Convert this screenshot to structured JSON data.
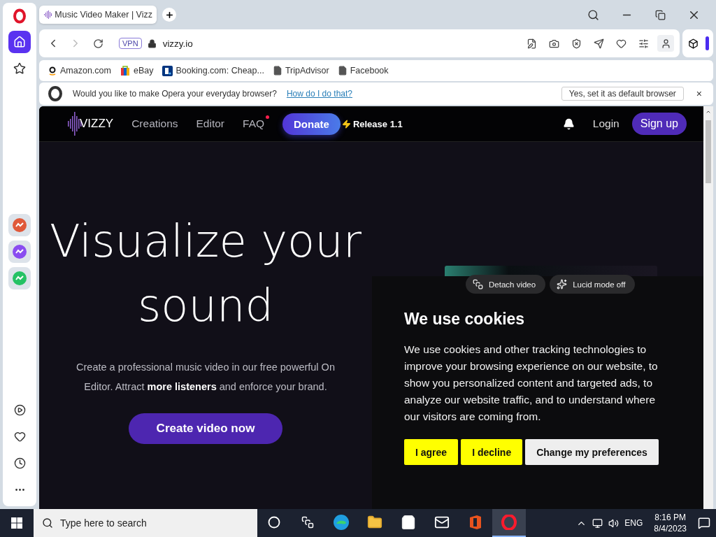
{
  "sidebar": {
    "top": [
      {
        "kind": "home",
        "selected": true
      },
      {
        "kind": "star",
        "selected": false
      }
    ],
    "apps": [
      {
        "kind": "aria"
      },
      {
        "kind": "messenger"
      },
      {
        "kind": "whatsapp"
      }
    ],
    "bottom": [
      {
        "kind": "player"
      },
      {
        "kind": "heart"
      },
      {
        "kind": "clock"
      },
      {
        "kind": "more"
      }
    ]
  },
  "browser": {
    "tab": {
      "title": "Music Video Maker | Vizz",
      "selected": true
    },
    "address": {
      "vpn_badge": "VPN",
      "url": "vizzy.io"
    },
    "bookmarks": [
      {
        "label": "Amazon.com",
        "kind": "amazon"
      },
      {
        "label": "eBay",
        "kind": "ebay"
      },
      {
        "label": "Booking.com: Cheap...",
        "kind": "booking"
      },
      {
        "label": "TripAdvisor",
        "kind": "page"
      },
      {
        "label": "Facebook",
        "kind": "page"
      }
    ],
    "default_prompt": {
      "message": "Would you like to make Opera your everyday browser?",
      "link": "How do I do that?",
      "button": "Yes, set it as default browser",
      "close": "×"
    }
  },
  "site": {
    "logo": "VIZZY",
    "nav": [
      {
        "label": "Creations",
        "badge": false
      },
      {
        "label": "Editor",
        "badge": false
      },
      {
        "label": "FAQ",
        "badge": true
      }
    ],
    "donate": "Donate",
    "release": "Release 1.1",
    "login": "Login",
    "signup": "Sign up"
  },
  "hero": {
    "title_lines": [
      "Visualize your",
      "sound"
    ],
    "subtitle_lines": [
      "Create a professional music video in our free powerful On",
      "Editor. Attract **more listeners** and enforce your brand."
    ],
    "cta": "Create video now"
  },
  "video_controls": [
    {
      "label": "Detach video",
      "kind": "detach"
    },
    {
      "label": "Lucid mode off",
      "kind": "lucid"
    }
  ],
  "cookies": {
    "title": "We use cookies",
    "body": "We use cookies and other tracking technologies to improve your browsing experience on our website, to show you personalized content and targeted ads, to analyze our website traffic, and to understand where our visitors are coming from.",
    "buttons": [
      {
        "label": "I agree",
        "kind": "primary"
      },
      {
        "label": "I decline",
        "kind": "primary"
      },
      {
        "label": "Change my preferences",
        "kind": "secondary"
      }
    ]
  },
  "taskbar": {
    "search_placeholder": "Type here to search",
    "apps": [
      {
        "kind": "cortana",
        "selected": false
      },
      {
        "kind": "taskview",
        "selected": false
      },
      {
        "kind": "edge",
        "selected": false
      },
      {
        "kind": "explorer",
        "selected": false
      },
      {
        "kind": "store",
        "selected": false
      },
      {
        "kind": "mail",
        "selected": false
      },
      {
        "kind": "office",
        "selected": false
      },
      {
        "kind": "opera",
        "selected": true
      }
    ],
    "language": "ENG",
    "time": "8:16 PM",
    "date": "8/4/2023"
  }
}
